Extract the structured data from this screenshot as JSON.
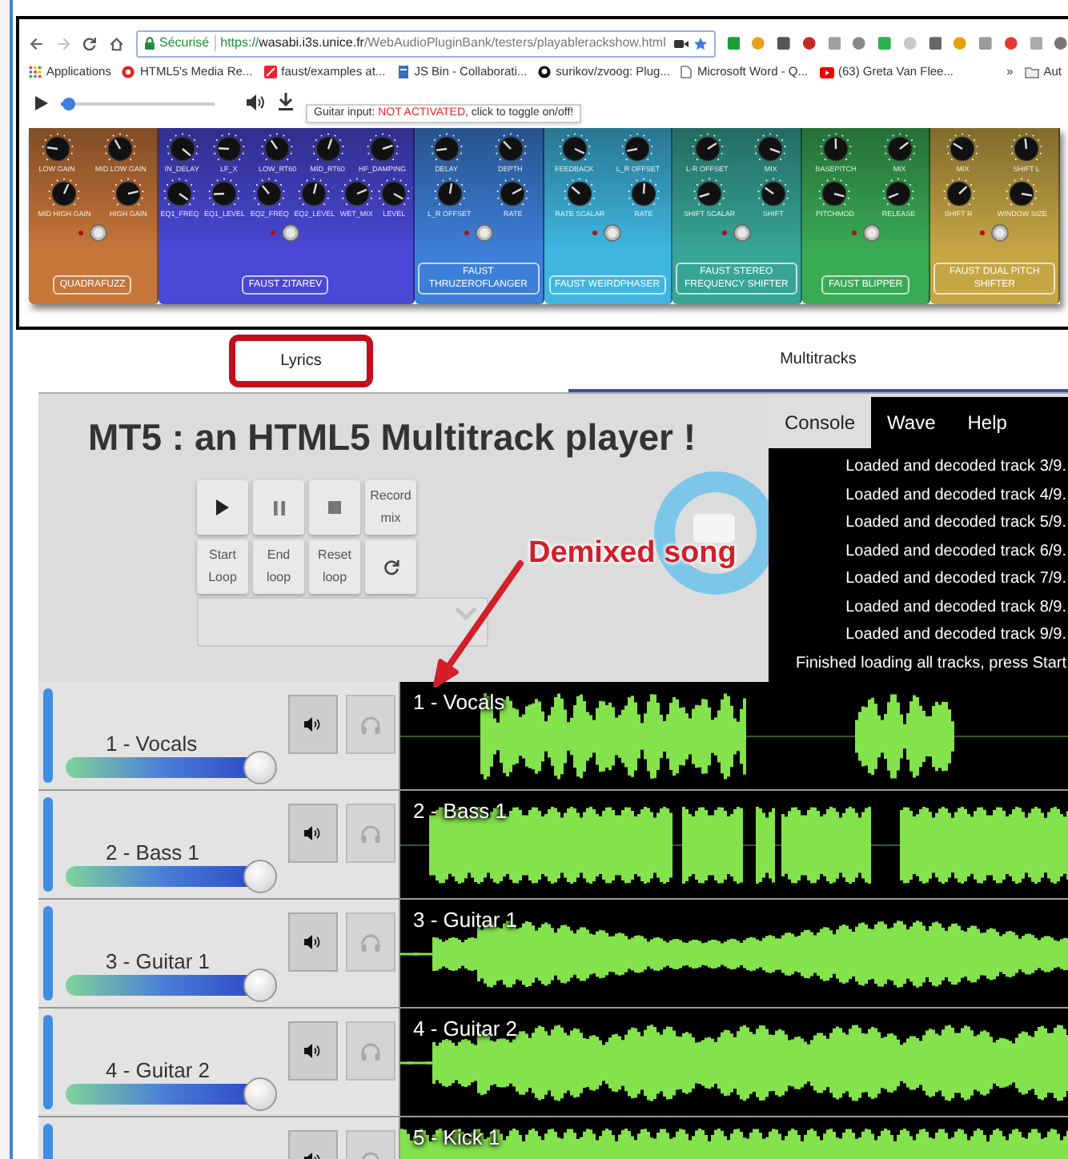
{
  "browser": {
    "security_label": "Sécurisé",
    "url": {
      "scheme": "https://",
      "host": "wasabi.i3s.unice.fr",
      "path": "/WebAudioPluginBank/testers/playablerackshow.html"
    },
    "bookmarks": [
      {
        "label": "Applications"
      },
      {
        "label": "HTML5's Media Re..."
      },
      {
        "label": "faust/examples at..."
      },
      {
        "label": "JS Bin - Collaborati..."
      },
      {
        "label": "surikov/zvoog: Plug..."
      },
      {
        "label": "Microsoft Word - Q..."
      },
      {
        "label": "(63) Greta Van Flee..."
      }
    ],
    "more_bookmarks": "»",
    "folder": "Aut"
  },
  "player": {
    "level": 0.05,
    "tooltip": {
      "label": "Guitar input:",
      "status": "NOT ACTIVATED",
      "hint": ", click to toggle on/off!"
    }
  },
  "pedals": [
    {
      "name": "QUADRAFUZZ",
      "color": "#c7763a",
      "knob_rows": [
        [
          "LOW GAIN",
          "MID LOW GAIN"
        ],
        [
          "MID HIGH GAIN",
          "HIGH GAIN"
        ]
      ]
    },
    {
      "name": "FAUST ZITAREV",
      "color": "#4a48d6",
      "knob_rows": [
        [
          "IN_DELAY",
          "LF_X",
          "LOW_RT60",
          "MID_RT60",
          "HF_DAMPING"
        ],
        [
          "EQ1_FREQ",
          "EQ1_LEVEL",
          "EQ2_FREQ",
          "EQ2_LEVEL",
          "WET_MIX",
          "LEVEL"
        ]
      ]
    },
    {
      "name": "FAUST THRUZEROFLANGER",
      "color": "#3d7fd8",
      "knob_rows": [
        [
          "DELAY",
          "DEPTH"
        ],
        [
          "L_R OFFSET",
          "RATE"
        ]
      ]
    },
    {
      "name": "FAUST WEIRDPHASER",
      "color": "#3fb6e0",
      "knob_rows": [
        [
          "FEEDBACK",
          "L_R OFFSET"
        ],
        [
          "RATE SCALAR",
          "RATE"
        ]
      ]
    },
    {
      "name": "FAUST STEREO FREQUENCY SHIFTER",
      "color": "#37a596",
      "knob_rows": [
        [
          "L-R OFFSET",
          "MIX"
        ],
        [
          "SHIFT SCALAR",
          "SHIFT"
        ]
      ]
    },
    {
      "name": "FAUST BLIPPER",
      "color": "#3aab55",
      "knob_rows": [
        [
          "BASEPITCH",
          "MIX"
        ],
        [
          "PITCHMOD",
          "RELEASE"
        ]
      ]
    },
    {
      "name": "FAUST DUAL PITCH SHIFTER",
      "color": "#c6a544",
      "knob_rows": [
        [
          "MIX",
          "SHIFT L"
        ],
        [
          "SHIFT R",
          "WINDOW SIZE"
        ]
      ]
    }
  ],
  "tabs": [
    {
      "label": "Lyrics",
      "selected": false,
      "highlighted": true
    },
    {
      "label": "Multitracks",
      "selected": true,
      "highlighted": false
    }
  ],
  "mt5": {
    "title": "MT5 : an HTML5 Multitrack player !",
    "transport": [
      {
        "kind": "play"
      },
      {
        "kind": "pause"
      },
      {
        "kind": "stop"
      },
      {
        "kind": "text",
        "label": "Record mix"
      },
      {
        "kind": "text",
        "label": "Start Loop"
      },
      {
        "kind": "text",
        "label": "End loop"
      },
      {
        "kind": "text",
        "label": "Reset loop"
      },
      {
        "kind": "reload"
      }
    ],
    "annotation": "Demixed song",
    "console": {
      "tabs": [
        {
          "label": "Console",
          "selected": true
        },
        {
          "label": "Wave",
          "selected": false
        },
        {
          "label": "Help",
          "selected": false
        }
      ],
      "lines": [
        "Loaded and decoded track 3/9.",
        "Loaded and decoded track 4/9.",
        "Loaded and decoded track 5/9.",
        "Loaded and decoded track 6/9.",
        "Loaded and decoded track 7/9.",
        "Loaded and decoded track 8/9.",
        "Loaded and decoded track 9/9.",
        "Finished loading all tracks, press Start"
      ]
    },
    "tracks": [
      {
        "name": "1 - Vocals",
        "wave_label": "1 - Vocals",
        "level": 0.9,
        "muted": false,
        "solo": false
      },
      {
        "name": "2 - Bass 1",
        "wave_label": "2 - Bass 1",
        "level": 0.9,
        "muted": false,
        "solo": false
      },
      {
        "name": "3 - Guitar 1",
        "wave_label": "3 - Guitar 1",
        "level": 0.9,
        "muted": false,
        "solo": false
      },
      {
        "name": "4 - Guitar 2",
        "wave_label": "4 - Guitar 2",
        "level": 0.9,
        "muted": false,
        "solo": false
      },
      {
        "wave_label": "5 - Kick 1",
        "muted": false,
        "solo": false
      }
    ]
  }
}
